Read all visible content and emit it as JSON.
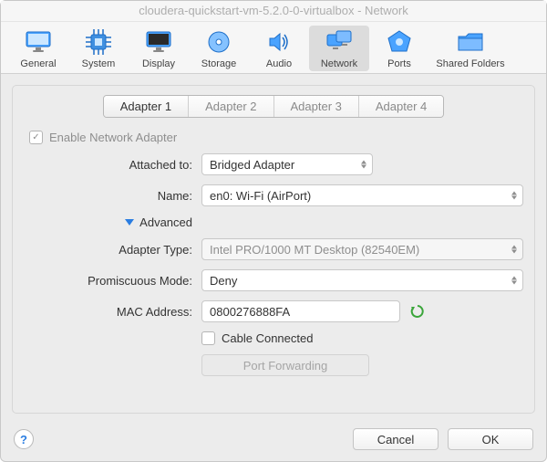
{
  "window": {
    "title": "cloudera-quickstart-vm-5.2.0-0-virtualbox - Network"
  },
  "toolbar": {
    "general": "General",
    "system": "System",
    "display": "Display",
    "storage": "Storage",
    "audio": "Audio",
    "network": "Network",
    "ports": "Ports",
    "shared_folders": "Shared Folders"
  },
  "tabs": {
    "a1": "Adapter 1",
    "a2": "Adapter 2",
    "a3": "Adapter 3",
    "a4": "Adapter 4"
  },
  "form": {
    "enable_label": "Enable Network Adapter",
    "attached_label": "Attached to:",
    "attached_value": "Bridged Adapter",
    "name_label": "Name:",
    "name_value": "en0: Wi-Fi (AirPort)",
    "advanced_label": "Advanced",
    "adapter_type_label": "Adapter Type:",
    "adapter_type_value": "Intel PRO/1000 MT Desktop (82540EM)",
    "promisc_label": "Promiscuous Mode:",
    "promisc_value": "Deny",
    "mac_label": "MAC Address:",
    "mac_value": "0800276888FA",
    "cable_label": "Cable Connected",
    "port_forwarding": "Port Forwarding"
  },
  "footer": {
    "help": "?",
    "cancel": "Cancel",
    "ok": "OK"
  }
}
